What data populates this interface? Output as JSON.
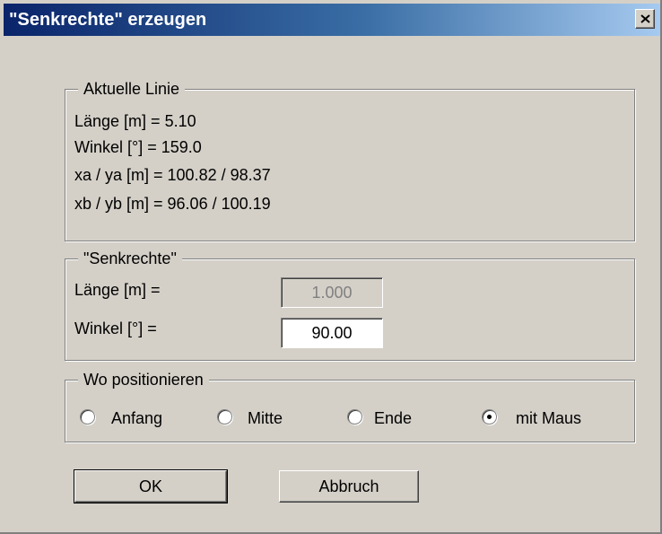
{
  "window": {
    "title": "\"Senkrechte\" erzeugen",
    "close_label": "Schließen"
  },
  "current_line": {
    "group_label": "Aktuelle Linie",
    "lines": [
      "Länge [m] = 5.10",
      "Winkel [°] = 159.0",
      "xa / ya [m] = 100.82 / 98.37",
      "xb / yb [m] = 96.06 / 100.19"
    ]
  },
  "perpendicular": {
    "group_label": "\"Senkrechte\"",
    "length_label": "Länge [m] =",
    "length_value": "1.000",
    "angle_label": "Winkel [°] =",
    "angle_value": "90.00"
  },
  "position": {
    "group_label": "Wo positionieren",
    "options": [
      {
        "label": "Anfang",
        "checked": false
      },
      {
        "label": "Mitte",
        "checked": false
      },
      {
        "label": "Ende",
        "checked": false
      },
      {
        "label": "mit Maus",
        "checked": true
      }
    ]
  },
  "buttons": {
    "ok": "OK",
    "cancel": "Abbruch"
  },
  "colors": {
    "titlebar_start": "#0a246a",
    "titlebar_end": "#a6caf0",
    "dialog_bg": "#d4d0c8"
  }
}
